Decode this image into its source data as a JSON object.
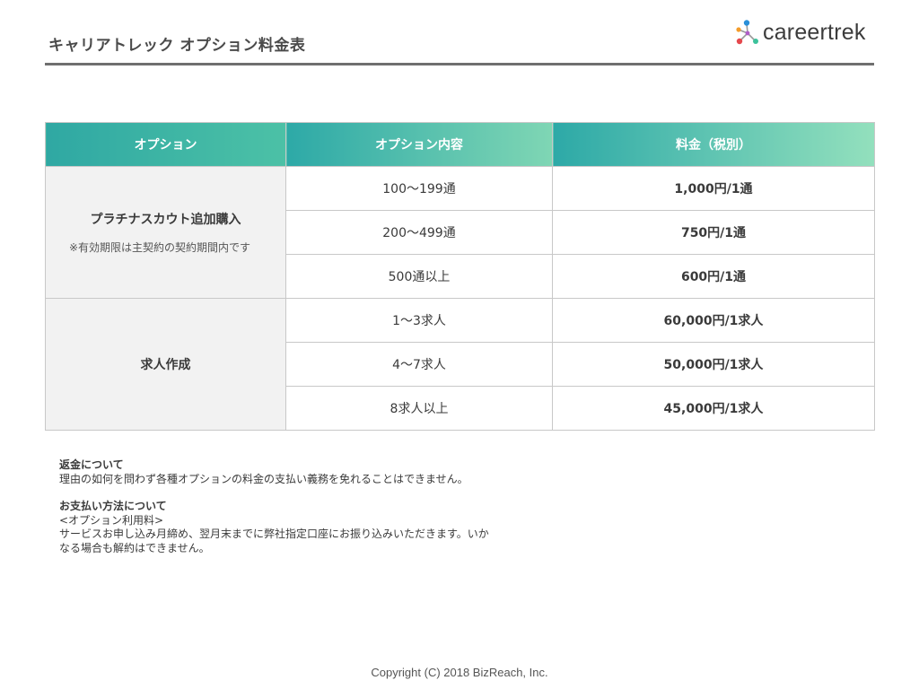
{
  "page": {
    "title": "キャリアトレック オプション料金表",
    "logo_text": "careertrek",
    "copyright": "Copyright (C) 2018 BizReach, Inc."
  },
  "table": {
    "headers": [
      "オプション",
      "オプション内容",
      "料金（税別）"
    ],
    "groups": [
      {
        "name": "プラチナスカウト追加購入",
        "note": "※有効期限は主契約の契約期間内です",
        "rows": [
          {
            "content": "100〜199通",
            "price": "1,000円/1通"
          },
          {
            "content": "200〜499通",
            "price": "750円/1通"
          },
          {
            "content": "500通以上",
            "price": "600円/1通"
          }
        ]
      },
      {
        "name": "求人作成",
        "note": "",
        "rows": [
          {
            "content": "1〜3求人",
            "price": "60,000円/1求人"
          },
          {
            "content": "4〜7求人",
            "price": "50,000円/1求人"
          },
          {
            "content": "8求人以上",
            "price": "45,000円/1求人"
          }
        ]
      }
    ]
  },
  "notes": {
    "refund_heading": "返金について",
    "refund_text": "理由の如何を問わず各種オプションの料金の支払い義務を免れることはできません。",
    "payment_heading": "お支払い方法について",
    "payment_sub": "<オプション利用料>",
    "payment_text": "サービスお申し込み月締め、翌月末までに弊社指定口座にお振り込みいただきます。いかなる場合も解約はできません。"
  },
  "colors": {
    "header_teal": "#2fa8a3",
    "header_mint": "#93e0bd",
    "option_cell_bg": "#f2f2f2",
    "title_rule": "#6f6f6f",
    "logo_blue": "#2a8fd8",
    "logo_orange": "#f39c2b",
    "logo_red": "#e5484d",
    "logo_green": "#3cc29b",
    "logo_purple": "#b05ec8"
  }
}
